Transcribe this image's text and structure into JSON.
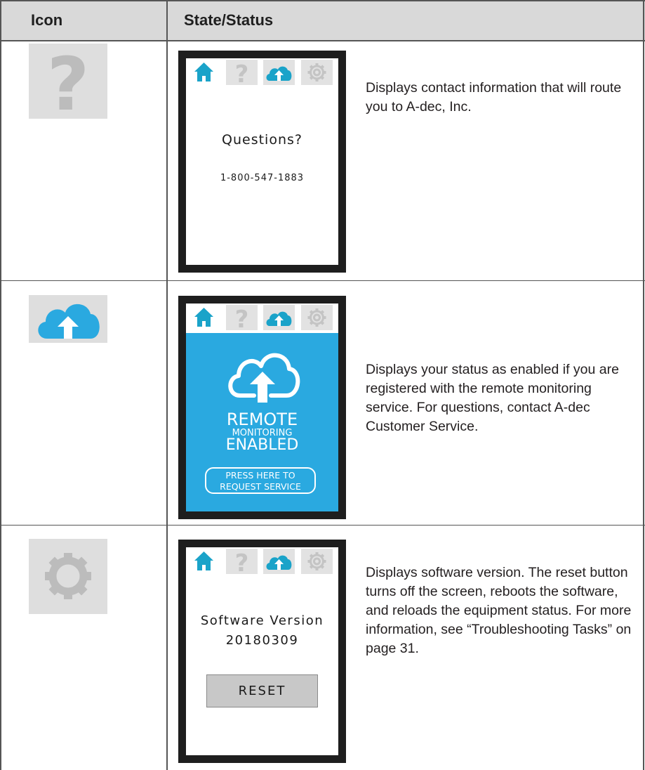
{
  "header": {
    "col_icon": "Icon",
    "col_state": "State/Status"
  },
  "rows": [
    {
      "icon": "question-icon",
      "screen": {
        "title": "Questions?",
        "phone": "1-800-547-1883"
      },
      "description": "Displays contact information that will route you to A-dec, Inc."
    },
    {
      "icon": "cloud-upload-icon",
      "screen": {
        "line1": "REMOTE",
        "line2": "MONITORING",
        "line3": "ENABLED",
        "button_line1": "PRESS HERE TO",
        "button_line2": "REQUEST SERVICE"
      },
      "description": "Displays your status as enabled if you are registered with the remote monitoring service. For questions, contact A-dec Customer Service."
    },
    {
      "icon": "gear-icon",
      "screen": {
        "title": "Software Version",
        "version": "20180309",
        "reset_label": "RESET"
      },
      "description": "Displays software version. The reset button turns off the screen, reboots the software, and reloads the equipment status. For more information, see “Troubleshooting Tasks” on page 31."
    }
  ],
  "colors": {
    "accent_blue": "#2aa9e0",
    "home_teal": "#1aa3c9",
    "icon_grey": "#bdbdbd",
    "tile_grey": "#dedede"
  }
}
